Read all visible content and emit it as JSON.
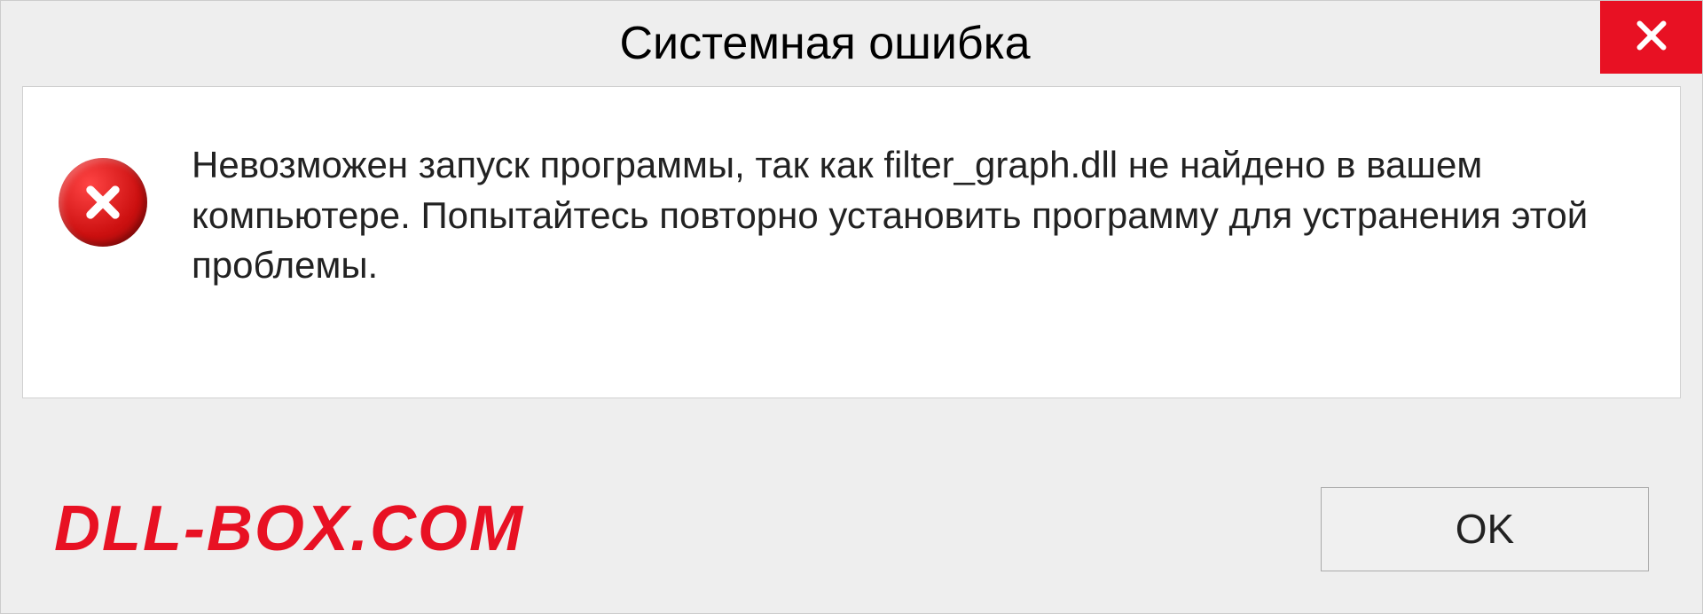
{
  "dialog": {
    "title": "Системная ошибка",
    "message": "Невозможен запуск программы, так как filter_graph.dll  не найдено в вашем компьютере. Попытайтесь повторно установить программу для устранения этой проблемы.",
    "ok_label": "OK"
  },
  "watermark": {
    "text": "DLL-BOX.COM"
  },
  "colors": {
    "close_button": "#e81123",
    "error_icon": "#cc1010",
    "watermark": "#e81123"
  }
}
